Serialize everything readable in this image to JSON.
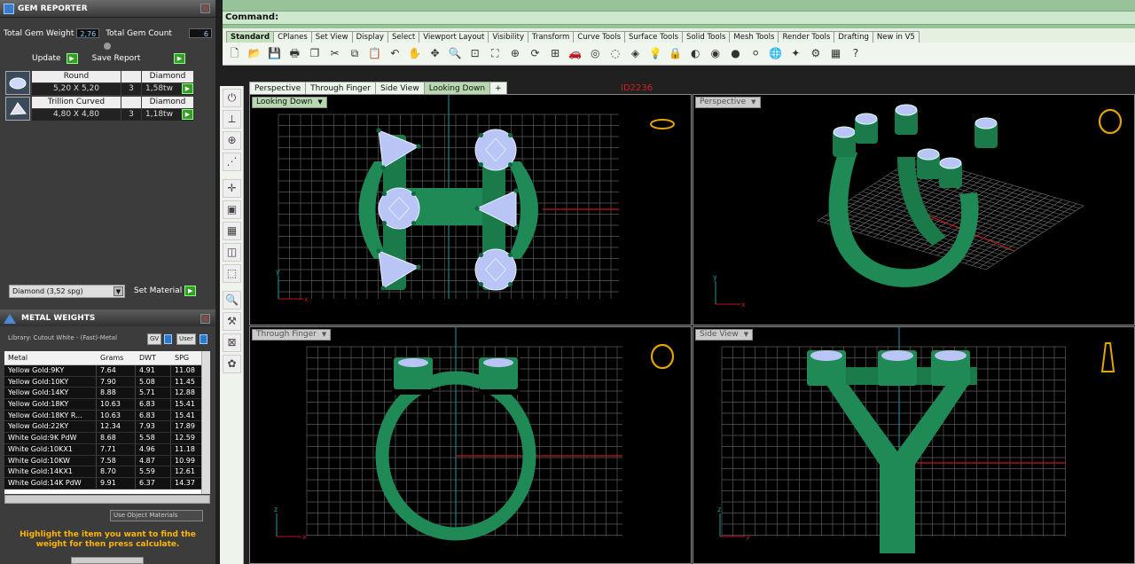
{
  "gem_reporter": {
    "title": "GEM REPORTER",
    "total_weight_label": "Total Gem Weight",
    "total_weight": "2,76",
    "total_count_label": "Total Gem Count",
    "total_count": "6",
    "update_label": "Update",
    "save_label": "Save Report",
    "gems": [
      {
        "shape": "Round",
        "type": "Diamond",
        "size": "5,20 X 5,20",
        "count": "3",
        "weight": "1,58tw"
      },
      {
        "shape": "Trillion Curved",
        "type": "Diamond",
        "size": "4,80 X 4,80",
        "count": "3",
        "weight": "1,18tw"
      }
    ],
    "material_select": "Diamond   (3,52 spg)",
    "set_material_label": "Set Material"
  },
  "metal_weights": {
    "title": "METAL WEIGHTS",
    "library": "Library: Cutout White - (Fast)-Metal",
    "gv_label": "GV",
    "user_label": "User",
    "headers": [
      "Metal",
      "Grams",
      "DWT",
      "SPG"
    ],
    "rows": [
      [
        "Yellow Gold:9KY",
        "7.64",
        "4.91",
        "11.08"
      ],
      [
        "Yellow Gold:10KY",
        "7.90",
        "5.08",
        "11.45"
      ],
      [
        "Yellow Gold:14KY",
        "8.88",
        "5.71",
        "12.88"
      ],
      [
        "Yellow Gold:18KY",
        "10.63",
        "6.83",
        "15.41"
      ],
      [
        "Yellow Gold:18KY R...",
        "10.63",
        "6.83",
        "15.41"
      ],
      [
        "Yellow Gold:22KY",
        "12.34",
        "7.93",
        "17.89"
      ],
      [
        "White Gold:9K PdW",
        "8.68",
        "5.58",
        "12.59"
      ],
      [
        "White Gold:10KX1",
        "7.71",
        "4.96",
        "11.18"
      ],
      [
        "White Gold:10KW",
        "7.58",
        "4.87",
        "10.99"
      ],
      [
        "White Gold:14KX1",
        "8.70",
        "5.59",
        "12.61"
      ],
      [
        "White Gold:14K PdW",
        "9.91",
        "6.37",
        "14.37"
      ]
    ],
    "use_object_label": "Use Object Materials",
    "hint": "Highlight the item you want to find the weight for then press calculate."
  },
  "command": {
    "label": "Command:"
  },
  "toolbar_tabs": [
    "Standard",
    "CPlanes",
    "Set View",
    "Display",
    "Select",
    "Viewport Layout",
    "Visibility",
    "Transform",
    "Curve Tools",
    "Surface Tools",
    "Solid Tools",
    "Mesh Tools",
    "Render Tools",
    "Drafting",
    "New in V5"
  ],
  "viewport_tabs": [
    "Perspective",
    "Through Finger",
    "Side View",
    "Looking Down"
  ],
  "id_label": "ID2236",
  "viewports": {
    "top_left": "Looking Down",
    "top_right": "Perspective",
    "bottom_left": "Through Finger",
    "bottom_right": "Side View"
  },
  "colors": {
    "metal": "#1f8a55",
    "gem": "#b9c6f5",
    "grid": "#5a5a5a",
    "axis_x": "#c01818",
    "axis_y": "#1a9aa0",
    "accent": "#3a9a2a"
  }
}
